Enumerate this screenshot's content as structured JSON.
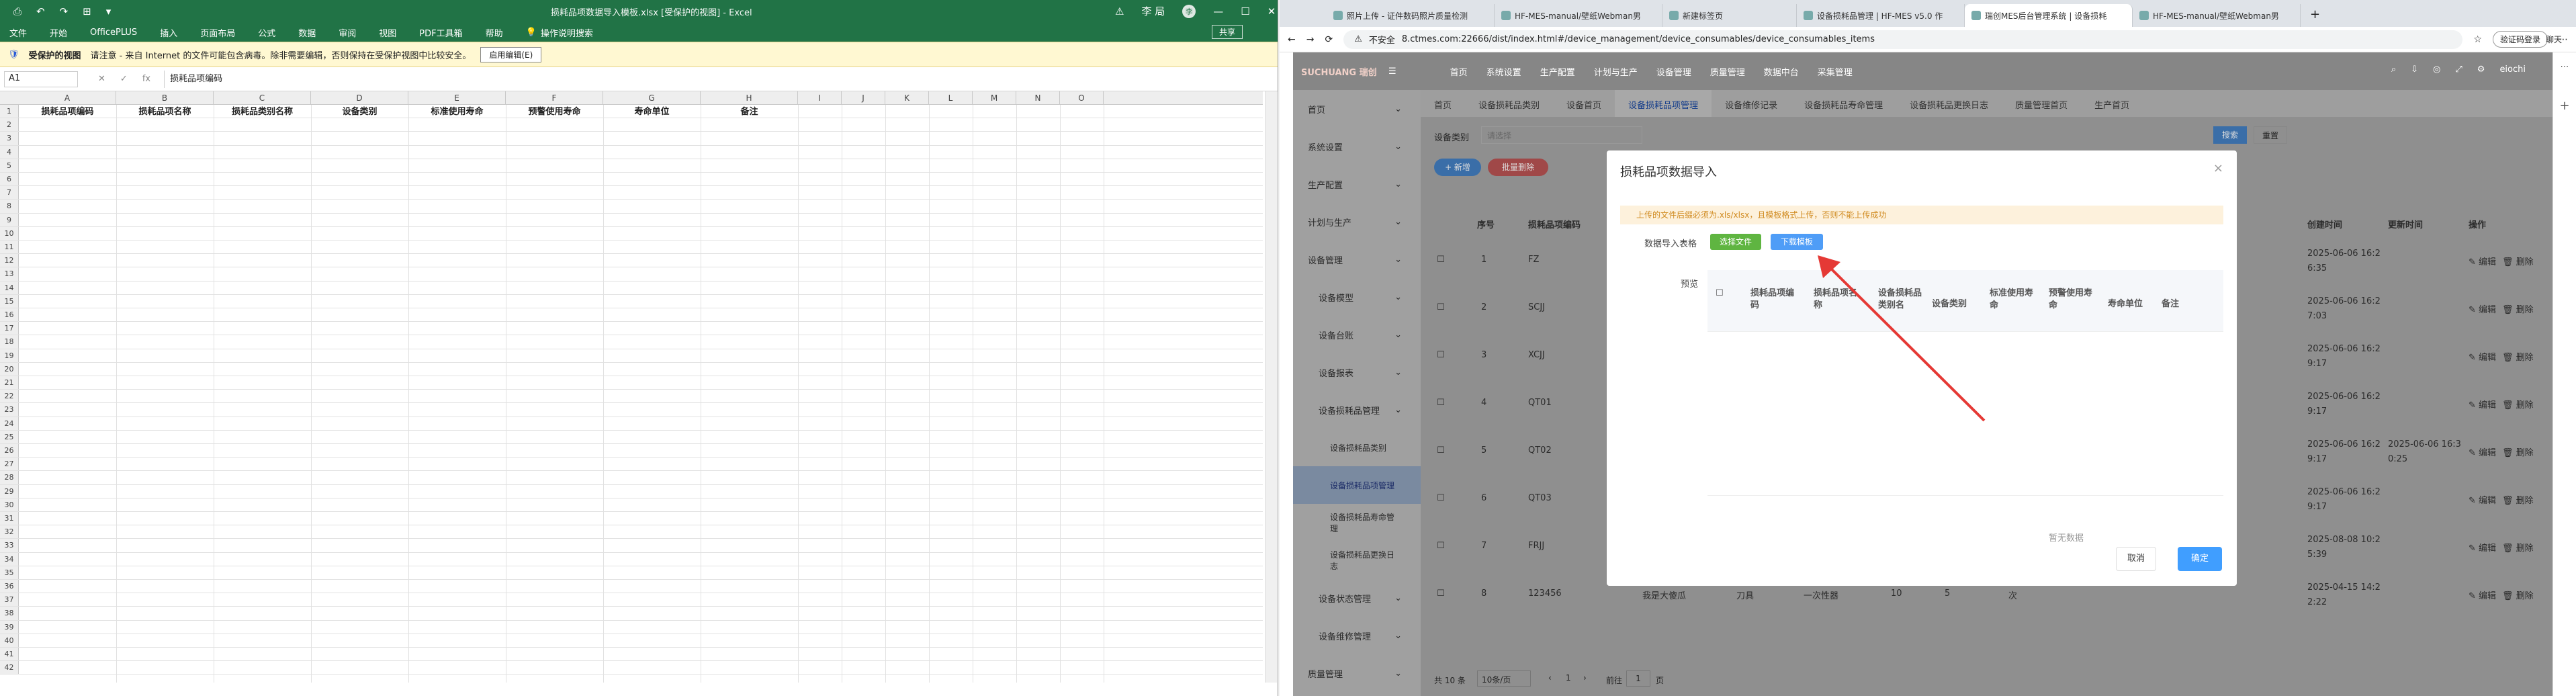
{
  "excel": {
    "quick": [
      "⎙",
      "↶",
      "↷",
      "⊞",
      "▾"
    ],
    "title": "损耗品项数据导入模板.xlsx [受保护的视图] - Excel",
    "user": "李 局",
    "avatar": "李",
    "win": [
      "—",
      "☐",
      "✕"
    ],
    "menu": [
      "文件",
      "开始",
      "OfficePLUS",
      "插入",
      "页面布局",
      "公式",
      "数据",
      "审阅",
      "视图",
      "PDF工具箱",
      "帮助",
      "操作说明搜索"
    ],
    "share": "共享",
    "pv_label": "受保护的视图",
    "pv_text": "请注意 - 来自 Internet 的文件可能包含病毒。除非需要编辑，否则保持在受保护视图中比较安全。",
    "pv_btn": "启用编辑(E)",
    "namebox": "A1",
    "fx": [
      "✕",
      "✓",
      "fx"
    ],
    "formula": "损耗品项编码",
    "columns": [
      "A",
      "B",
      "C",
      "D",
      "E",
      "F",
      "G",
      "H",
      "I",
      "J",
      "K",
      "L",
      "M",
      "N",
      "O"
    ],
    "headers": [
      "损耗品项编码",
      "损耗品项名称",
      "损耗品类别名称",
      "设备类别",
      "标准使用寿命",
      "预警使用寿命",
      "寿命单位",
      "备注"
    ],
    "rows": 42
  },
  "browser": {
    "tabs": [
      "照片上传 - 证件数码照片质量检测",
      "HF-MES-manual/壁纸Webman男",
      "新建标签页",
      "设备损耗品管理 | HF-MES v5.0 作",
      "瑞创MES后台管理系统 | 设备损耗",
      "HF-MES-manual/壁纸Webman男"
    ],
    "nav_btns": [
      "←",
      "→",
      "⟳"
    ],
    "insecure": "不安全",
    "url": "8.ctmes.com:22666/dist/index.html#/device_management/device_consumables/device_consumables_items",
    "url_icons": [
      "☆",
      "⋯"
    ],
    "login": "验证码登录",
    "add_tab": "+",
    "right_icons": [
      "⋯",
      "聊天"
    ]
  },
  "app": {
    "logo": "SUCHUANG 瑞创",
    "nav": [
      "首页",
      "系统设置",
      "生产配置",
      "计划与生产",
      "设备管理",
      "质量管理",
      "数据中台",
      "采集管理"
    ],
    "right": [
      "⌕",
      "⇩",
      "◎",
      "⤢",
      "⚙",
      "eiochi"
    ],
    "sidebar": [
      {
        "label": "首页",
        "level": 0,
        "sel": false
      },
      {
        "label": "系统设置",
        "level": 0,
        "sel": false
      },
      {
        "label": "生产配置",
        "level": 0,
        "sel": false
      },
      {
        "label": "计划与生产",
        "level": 0,
        "sel": false
      },
      {
        "label": "设备管理",
        "level": 0,
        "sel": false
      },
      {
        "label": "设备模型",
        "level": 1,
        "sel": false
      },
      {
        "label": "设备台账",
        "level": 1,
        "sel": false
      },
      {
        "label": "设备报表",
        "level": 1,
        "sel": false
      },
      {
        "label": "设备损耗品管理",
        "level": 1,
        "sel": false
      },
      {
        "label": "设备损耗品类别",
        "level": 2,
        "sel": false
      },
      {
        "label": "设备损耗品项管理",
        "level": 2,
        "sel": true
      },
      {
        "label": "设备损耗品寿命管理",
        "level": 2,
        "sel": false
      },
      {
        "label": "设备损耗品更换日志",
        "level": 2,
        "sel": false
      },
      {
        "label": "设备状态管理",
        "level": 1,
        "sel": false
      },
      {
        "label": "设备维修管理",
        "level": 1,
        "sel": false
      },
      {
        "label": "质量管理",
        "level": 0,
        "sel": false
      }
    ],
    "tabs": [
      "首页",
      "设备损耗品类别",
      "设备首页",
      "设备损耗品项管理",
      "设备维修记录",
      "设备损耗品寿命管理",
      "设备损耗品更换日志",
      "质量管理首页",
      "生产首页"
    ],
    "filter_label": "设备类别",
    "filter_placeholder": "请选择",
    "search_btn": "搜索",
    "reset_btn": "重置",
    "add_btn": "+ 新增",
    "del_btn": "批量删除",
    "table_headers": [
      "序号",
      "损耗品项编码",
      "创建时间",
      "更新时间",
      "操作"
    ],
    "rows": [
      {
        "no": "1",
        "code": "FZ",
        "created": "2025-06-06 16:2\n6:35",
        "updated": ""
      },
      {
        "no": "2",
        "code": "SCJJ",
        "created": "2025-06-06 16:2\n7:03",
        "updated": ""
      },
      {
        "no": "3",
        "code": "XCJJ",
        "created": "2025-06-06 16:2\n9:17",
        "updated": ""
      },
      {
        "no": "4",
        "code": "QT01",
        "created": "2025-06-06 16:2\n9:17",
        "updated": ""
      },
      {
        "no": "5",
        "code": "QT02",
        "created": "2025-06-06 16:2\n9:17",
        "updated": "2025-06-06 16:3\n0:25"
      },
      {
        "no": "6",
        "code": "QT03",
        "created": "2025-06-06 16:2\n9:17",
        "updated": ""
      },
      {
        "no": "7",
        "code": "FRJJ",
        "created": "2025-08-08 10:2\n5:39",
        "updated": ""
      },
      {
        "no": "8",
        "code": "123456",
        "name": "我是大傻瓜",
        "cat": "刀具",
        "type": "一次性器",
        "std": "10",
        "warn": "5",
        "unit": "次",
        "created": "2025-04-15 14:2\n2:22",
        "updated": ""
      }
    ],
    "edit": "编辑",
    "delete": "删除",
    "total": "共 10 条",
    "pagesize": "10条/页",
    "page": "1",
    "goto": "前往",
    "goto_page": "1",
    "goto_unit": "页"
  },
  "modal": {
    "title": "损耗品项数据导入",
    "close": "×",
    "alert": "上传的文件后缀必须为.xls/xlsx，且模板格式上传，否则不能上传成功",
    "import_label": "数据导入表格",
    "select_file": "选择文件",
    "download": "下载模板",
    "preview_label": "预览",
    "headers": [
      "损耗品项编码",
      "损耗品项名称",
      "设备损耗品类别名",
      "设备类别",
      "标准使用寿命",
      "预警使用寿命",
      "寿命单位",
      "备注"
    ],
    "empty": "暂无数据",
    "cancel": "取消",
    "ok": "确定"
  },
  "colors": {
    "excel_green": "#217346",
    "primary": "#409eff",
    "green_btn": "#5fb541",
    "arrow": "#e53935"
  }
}
